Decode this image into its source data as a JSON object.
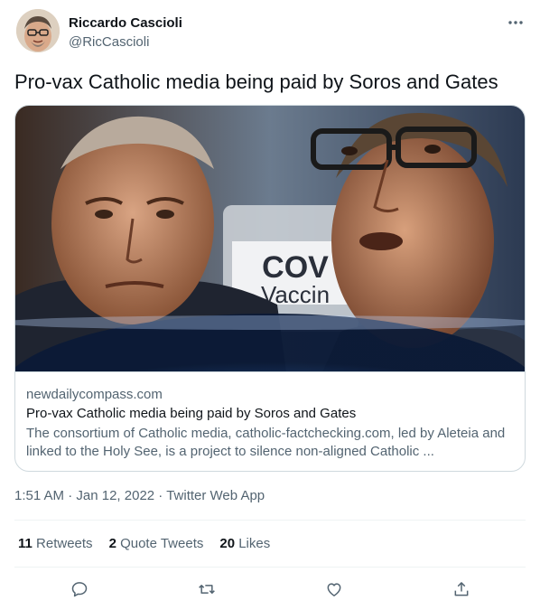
{
  "author": {
    "name": "Riccardo Cascioli",
    "handle": "@RicCascioli"
  },
  "tweet": {
    "text": "Pro-vax Catholic media being paid by Soros and Gates"
  },
  "card": {
    "image_label_line1": "COV",
    "image_label_line2": "Vaccin",
    "domain": "newdailycompass.com",
    "title": "Pro-vax Catholic media being paid by Soros and Gates",
    "description": "The consortium of Catholic media, catholic-factchecking.com, led by Aleteia and linked to the Holy See, is a project to silence non-aligned Catholic ..."
  },
  "meta": {
    "time": "1:51 AM",
    "separator1": " · ",
    "date": "Jan 12, 2022",
    "separator2": " · ",
    "app": "Twitter Web App"
  },
  "stats": {
    "retweets_count": "11",
    "retweets_label": "Retweets",
    "quotes_count": "2",
    "quotes_label": "Quote Tweets",
    "likes_count": "20",
    "likes_label": "Likes"
  },
  "icons": {
    "more": "more-horizontal-icon",
    "reply": "reply-icon",
    "retweet": "retweet-icon",
    "like": "heart-icon",
    "share": "share-icon"
  },
  "colors": {
    "text_primary": "#0f1419",
    "text_secondary": "#536471",
    "border": "#cfd9de",
    "divider": "#eff3f4"
  }
}
